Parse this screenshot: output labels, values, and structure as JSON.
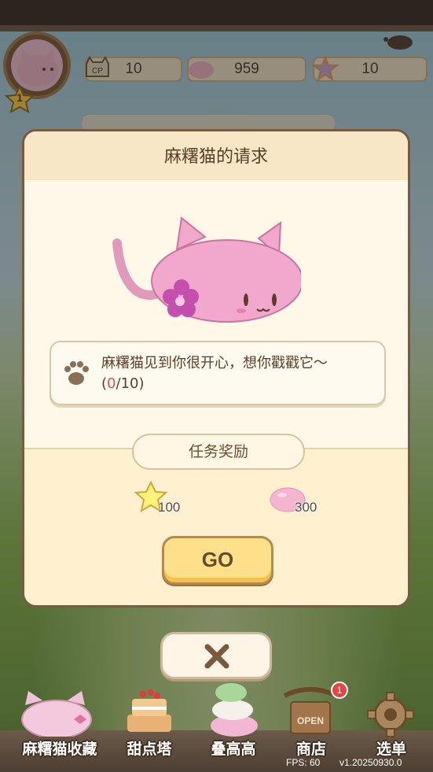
{
  "hud": {
    "level": "1",
    "cp_label": "CP",
    "cp_value": "10",
    "mochi_value": "959",
    "gem_value": "10"
  },
  "modal": {
    "title": "麻糬猫的请求",
    "quest_text": "麻糬猫见到你很开心，想你戳戳它～",
    "progress_open": "(",
    "progress_current": "0",
    "progress_sep": "/",
    "progress_total": "10",
    "progress_close": ")",
    "reward_label": "任务奖励",
    "rewards": [
      {
        "icon": "star-icon",
        "amount": "100"
      },
      {
        "icon": "mochi-icon",
        "amount": "300"
      }
    ],
    "go_label": "GO"
  },
  "nav": {
    "items": [
      {
        "label": "麻糬猫收藏",
        "icon": "cat-collection-icon"
      },
      {
        "label": "甜点塔",
        "icon": "cake-tower-icon"
      },
      {
        "label": "叠高高",
        "icon": "stacked-cats-icon"
      },
      {
        "label": "商店",
        "icon": "shop-sign-icon",
        "badge": "1",
        "sign_text": "OPEN"
      },
      {
        "label": "选单",
        "icon": "gear-icon"
      }
    ]
  },
  "debug": {
    "fps": "FPS: 60",
    "version": "v1.20250930.0"
  },
  "colors": {
    "accent_pink": "#f2a8cc",
    "progress_red": "#e34f4f",
    "go_yellow": "#ffe08a"
  }
}
